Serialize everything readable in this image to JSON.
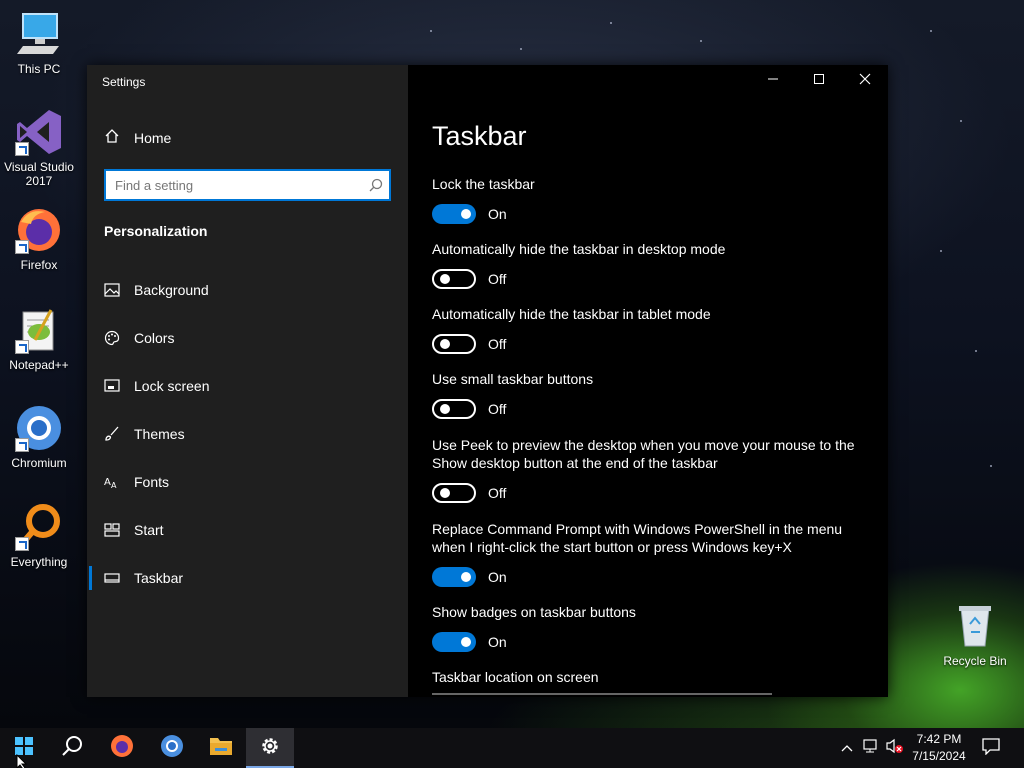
{
  "desktop": {
    "icons": [
      {
        "label": "This PC",
        "icon": "computer-icon"
      },
      {
        "label": "Visual Studio\n2017",
        "icon": "visual-studio-icon"
      },
      {
        "label": "Firefox",
        "icon": "firefox-icon"
      },
      {
        "label": "Notepad++",
        "icon": "notepadpp-icon"
      },
      {
        "label": "Chromium",
        "icon": "chromium-icon"
      },
      {
        "label": "Everything",
        "icon": "everything-icon"
      },
      {
        "label": "Recycle Bin",
        "icon": "recycle-bin-icon"
      }
    ]
  },
  "window": {
    "title": "Settings",
    "home_label": "Home",
    "search_placeholder": "Find a setting",
    "section_heading": "Personalization",
    "nav_items": [
      {
        "label": "Background",
        "icon": "image-icon"
      },
      {
        "label": "Colors",
        "icon": "palette-icon"
      },
      {
        "label": "Lock screen",
        "icon": "lock-screen-icon"
      },
      {
        "label": "Themes",
        "icon": "brush-icon"
      },
      {
        "label": "Fonts",
        "icon": "fonts-icon"
      },
      {
        "label": "Start",
        "icon": "start-icon"
      },
      {
        "label": "Taskbar",
        "icon": "taskbar-icon",
        "selected": true
      }
    ],
    "caption_buttons": [
      "minimize-icon",
      "maximize-icon",
      "close-icon"
    ]
  },
  "page": {
    "title": "Taskbar",
    "settings": [
      {
        "label": "Lock the taskbar",
        "on": true,
        "state": "On"
      },
      {
        "label": "Automatically hide the taskbar in desktop mode",
        "on": false,
        "state": "Off"
      },
      {
        "label": "Automatically hide the taskbar in tablet mode",
        "on": false,
        "state": "Off"
      },
      {
        "label": "Use small taskbar buttons",
        "on": false,
        "state": "Off"
      },
      {
        "label": "Use Peek to preview the desktop when you move your mouse to the Show desktop button at the end of the taskbar",
        "on": false,
        "state": "Off"
      },
      {
        "label": "Replace Command Prompt with Windows PowerShell in the menu when I right-click the start button or press Windows key+X",
        "on": true,
        "state": "On"
      },
      {
        "label": "Show badges on taskbar buttons",
        "on": true,
        "state": "On"
      }
    ],
    "location_label": "Taskbar location on screen"
  },
  "taskbar": {
    "buttons": [
      "windows-start-icon",
      "search-icon",
      "firefox-icon",
      "chromium-icon",
      "file-explorer-icon",
      "settings-gear-icon"
    ],
    "active_button": "settings-gear-icon",
    "time": "7:42 PM",
    "date": "7/15/2024",
    "tray_icons": [
      "chevron-up-icon",
      "network-icon",
      "volume-muted-icon",
      "action-center-icon"
    ]
  },
  "colors": {
    "accent": "#0078d7",
    "left_pane": "#1f1f1f",
    "right_pane": "#000000"
  }
}
